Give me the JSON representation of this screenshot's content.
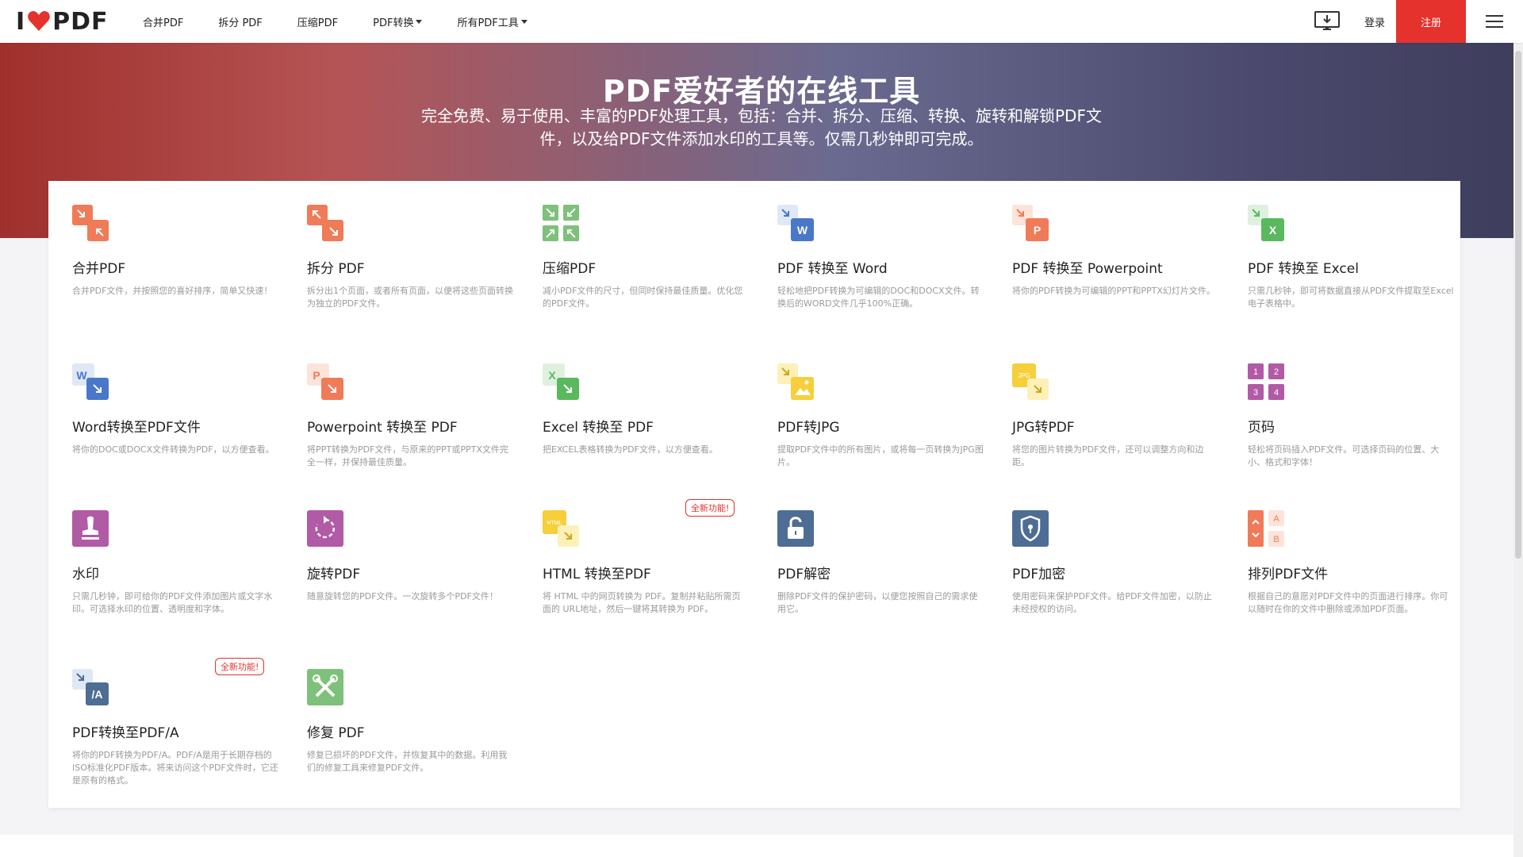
{
  "header": {
    "logo_left": "I",
    "logo_right": "PDF",
    "nav": [
      {
        "label": "合并PDF",
        "dropdown": false
      },
      {
        "label": "拆分 PDF",
        "dropdown": false
      },
      {
        "label": "压缩PDF",
        "dropdown": false
      },
      {
        "label": "PDF转换",
        "dropdown": true
      },
      {
        "label": "所有PDF工具",
        "dropdown": true
      }
    ],
    "login": "登录",
    "signup": "注册"
  },
  "hero": {
    "title": "PDF爱好者的在线工具",
    "subtitle": "完全免费、易于使用、丰富的PDF处理工具，包括：合并、拆分、压缩、转换、旋转和解锁PDF文件，以及给PDF文件添加水印的工具等。仅需几秒钟即可完成。"
  },
  "colors": {
    "accent": "#e5322d",
    "merge": "#f07b58",
    "compress": "#7ec17a",
    "word": "#4a78c9",
    "ppt": "#f07b58",
    "excel": "#5ab85e",
    "jpg": "#f6cf3a",
    "page": "#b15aa6",
    "protect": "#4e6d94"
  },
  "tools": [
    {
      "name": "合并PDF",
      "desc": "合并PDF文件，并按照您的喜好排序，简单又快速！",
      "icon": "merge-icon"
    },
    {
      "name": "拆分 PDF",
      "desc": "拆分出1个页面，或者所有页面，以便将这些页面转换为独立的PDF文件。",
      "icon": "split-icon"
    },
    {
      "name": "压缩PDF",
      "desc": "减小PDF文件的尺寸，但同时保持最佳质量。优化您的PDF文件。",
      "icon": "compress-icon"
    },
    {
      "name": "PDF 转换至 Word",
      "desc": "轻松地把PDF转换为可编辑的DOC和DOCX文件。转换后的WORD文件几乎100%正确。",
      "icon": "pdf-to-word-icon"
    },
    {
      "name": "PDF 转换至 Powerpoint",
      "desc": "将你的PDF转换为可编辑的PPT和PPTX幻灯片文件。",
      "icon": "pdf-to-ppt-icon"
    },
    {
      "name": "PDF 转换至 Excel",
      "desc": "只需几秒钟，即可将数据直接从PDF文件提取至Excel 电子表格中。",
      "icon": "pdf-to-excel-icon"
    },
    {
      "name": "Word转换至PDF文件",
      "desc": "将你的DOC或DOCX文件转换为PDF，以方便查看。",
      "icon": "word-to-pdf-icon"
    },
    {
      "name": "Powerpoint 转换至 PDF",
      "desc": "将PPT转换为PDF文件，与原来的PPT或PPTX文件完全一样，并保持最佳质量。",
      "icon": "ppt-to-pdf-icon"
    },
    {
      "name": "Excel 转换至 PDF",
      "desc": "把EXCEL表格转换为PDF文件，以方便查看。",
      "icon": "excel-to-pdf-icon"
    },
    {
      "name": "PDF转JPG",
      "desc": "提取PDF文件中的所有图片，或将每一页转换为JPG图片。",
      "icon": "pdf-to-jpg-icon"
    },
    {
      "name": "JPG转PDF",
      "desc": "将您的图片转换为PDF文件，还可以调整方向和边距。",
      "icon": "jpg-to-pdf-icon"
    },
    {
      "name": "页码",
      "desc": "轻松将页码插入PDF文件。可选择页码的位置、大小、格式和字体！",
      "icon": "page-numbers-icon"
    },
    {
      "name": "水印",
      "desc": "只需几秒钟，即可给你的PDF文件添加图片或文字水印。可选择水印的位置、透明度和字体。",
      "icon": "watermark-icon"
    },
    {
      "name": "旋转PDF",
      "desc": "随意旋转您的PDF文件。一次旋转多个PDF文件！",
      "icon": "rotate-icon"
    },
    {
      "name": "HTML 转换至PDF",
      "desc": "将 HTML 中的网页转换为 PDF。复制并粘贴所需页面的 URL地址，然后一键将其转换为 PDF。",
      "icon": "html-to-pdf-icon",
      "badge": "全新功能!"
    },
    {
      "name": "PDF解密",
      "desc": "删除PDF文件的保护密码，以便您按照自己的需求使用它。",
      "icon": "unlock-icon"
    },
    {
      "name": "PDF加密",
      "desc": "使用密码来保护PDF文件。给PDF文件加密，以防止未经授权的访问。",
      "icon": "protect-icon"
    },
    {
      "name": "排列PDF文件",
      "desc": "根据自己的意愿对PDF文件中的页面进行排序。你可以随时在你的文件中删除或添加PDF页面。",
      "icon": "organize-icon"
    },
    {
      "name": "PDF转换至PDF/A",
      "desc": "将你的PDF转换为PDF/A。PDF/A是用于长期存档的ISO标准化PDF版本。将来访问这个PDF文件时，它还是原有的格式。",
      "icon": "pdfa-icon",
      "badge": "全新功能!"
    },
    {
      "name": "修复 PDF",
      "desc": "修复已损坏的PDF文件，并恢复其中的数据。利用我们的修复工具来修复PDF文件。",
      "icon": "repair-icon"
    }
  ],
  "icon_letters": {
    "word": "W",
    "ppt": "P",
    "excel": "X",
    "jpg": "JPG",
    "html": "HTML",
    "pdfa": "/A",
    "pages": [
      "1",
      "2",
      "3",
      "4"
    ],
    "org": [
      "A",
      "B"
    ]
  }
}
